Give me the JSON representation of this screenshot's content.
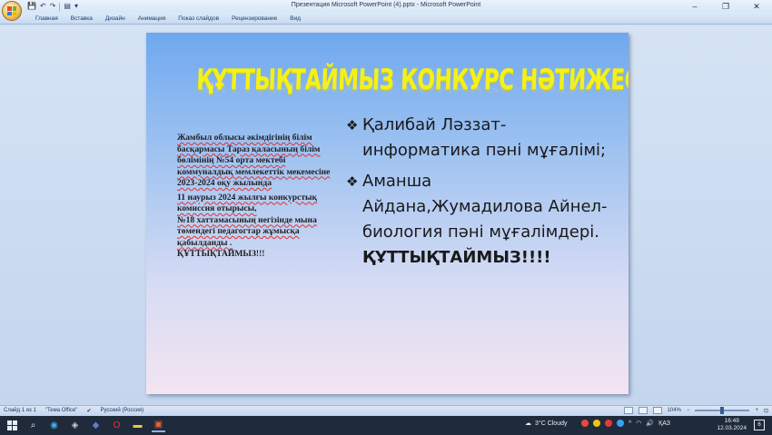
{
  "window": {
    "title": "Презентация Microsoft PowerPoint (4).pptx - Microsoft PowerPoint",
    "controls": [
      "–",
      "❐",
      "✕"
    ]
  },
  "ribbon": {
    "tabs": [
      "Главная",
      "Вставка",
      "Дизайн",
      "Анимация",
      "Показ слайдов",
      "Рецензирование",
      "Вид"
    ]
  },
  "slide": {
    "title": "ҚҰТТЫҚТАЙМЫЗ КОНКУРС НӘТИЖЕСІ !!!",
    "left_paragraphs": [
      "Жамбыл облысы әкімдігінің білім басқармасы Тараз қаласының білім бөлімінің №54 орта мектебі коммуналдық мемлекеттік мекемесіне  2023-2024 оқу жылында",
      "11 наурыз  2024 жылғы конкурстық комиссия отырысы,",
      "№18 хаттамасының негізінде мына төмендегі педагогтар жұмысқа қабылданды .",
      "ҚҰТТЫҚТАЙМЫЗ!!!"
    ],
    "bullets": [
      {
        "text": "Қалибай Ләззат-информатика пәні мұғалімі;"
      },
      {
        "text": "Аманша Айдана,Жумадилова Айнел-биология  пәні мұғалімдері.",
        "emphasis": "ҚҰТТЫҚТАЙМЫЗ!!!!"
      }
    ],
    "bullet_glyph": "❖"
  },
  "statusbar": {
    "slide_info": "Слайд 1 из 1",
    "theme": "\"Тема Office\"",
    "language": "Русский (Россия)",
    "zoom": "104%"
  },
  "taskbar": {
    "weather": "3°C  Cloudy",
    "lang": "ҚАЗ",
    "time": "16:49",
    "date": "12.03.2024",
    "notifications": "6"
  }
}
